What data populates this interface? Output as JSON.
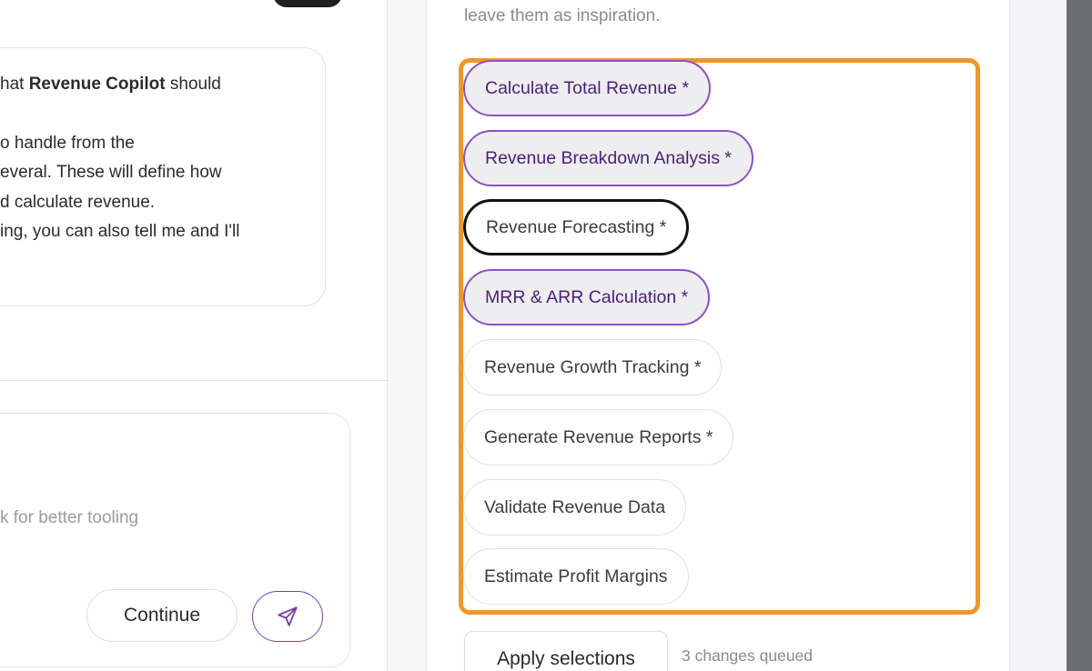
{
  "chat": {
    "line1_prefix": "hat ",
    "line1_bold": "Revenue Copilot",
    "line1_suffix": " should",
    "line2": "o handle from the",
    "line3": "everal. These will define how",
    "line4": "d calculate revenue.",
    "line5": "ing, you can also tell me and I'll"
  },
  "composer": {
    "placeholder": "k for better tooling",
    "continue_label": "Continue",
    "send_icon": "send-icon"
  },
  "capabilities": {
    "intro": "leave them as inspiration.",
    "chips": [
      {
        "label": "Calculate Total Revenue *",
        "state": "selected"
      },
      {
        "label": "Revenue Breakdown Analysis *",
        "state": "selected"
      },
      {
        "label": "Revenue Forecasting *",
        "state": "focused"
      },
      {
        "label": "MRR & ARR Calculation *",
        "state": "selected"
      },
      {
        "label": "Revenue Growth Tracking *",
        "state": "default"
      },
      {
        "label": "Generate Revenue Reports *",
        "state": "default"
      },
      {
        "label": "Validate Revenue Data",
        "state": "default"
      },
      {
        "label": "Estimate Profit Margins",
        "state": "default"
      }
    ],
    "apply_label": "Apply selections",
    "queued_text": "3 changes queued"
  },
  "colors": {
    "accent_purple": "#8c52c0",
    "highlight_orange": "#f0962b",
    "selected_chip_bg": "#eeeef0"
  }
}
